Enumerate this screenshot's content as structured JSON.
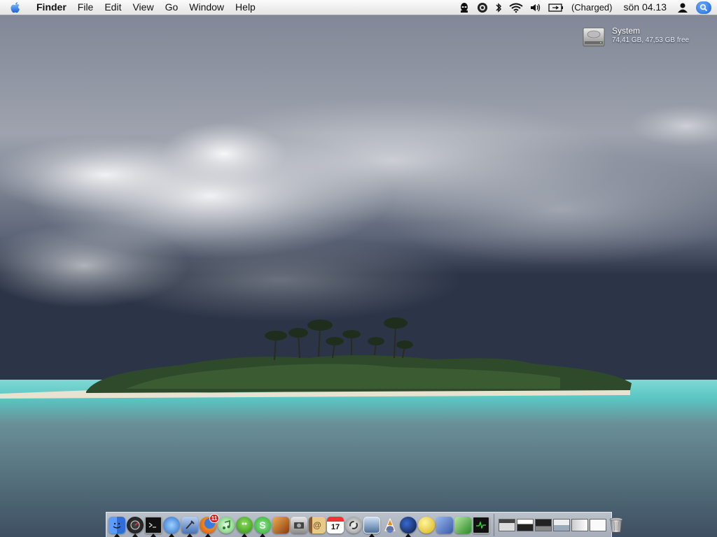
{
  "menubar": {
    "app_name": "Finder",
    "menus": [
      "File",
      "Edit",
      "View",
      "Go",
      "Window",
      "Help"
    ],
    "battery_status": "(Charged)",
    "clock": "sön 04.13"
  },
  "desktop_icon": {
    "name": "System",
    "info": "74,41 GB, 47,53 GB free"
  },
  "dock": {
    "badge_count": "11",
    "calendar_date": "17",
    "apps": [
      {
        "id": "finder",
        "icon": "finder-icon",
        "color": "#3a78d8"
      },
      {
        "id": "dashboard",
        "icon": "dashboard-icon",
        "color": "#222222"
      },
      {
        "id": "terminal",
        "icon": "terminal-icon",
        "color": "#1a1a1a"
      },
      {
        "id": "safari",
        "icon": "safari-icon",
        "color": "#4a9ae0"
      },
      {
        "id": "xcode",
        "icon": "xcode-icon",
        "color": "#6a8fd0"
      },
      {
        "id": "firefox",
        "icon": "firefox-icon",
        "color": "#e07a20"
      },
      {
        "id": "itunes",
        "icon": "itunes-icon",
        "color": "#5cc05c"
      },
      {
        "id": "adium",
        "icon": "adium-icon",
        "color": "#4caf2a"
      },
      {
        "id": "skype",
        "icon": "skype-icon",
        "color": "#3fb43f"
      },
      {
        "id": "photo-booth",
        "icon": "photo-icon",
        "color": "#b35e1e"
      },
      {
        "id": "iphoto",
        "icon": "camera-icon",
        "color": "#777777"
      },
      {
        "id": "address-book",
        "icon": "address-book-icon",
        "color": "#c89a4a"
      },
      {
        "id": "ical",
        "icon": "calendar-icon",
        "color": "#f4f4f4"
      },
      {
        "id": "sync",
        "icon": "sync-icon",
        "color": "#999999"
      },
      {
        "id": "preview",
        "icon": "preview-icon",
        "color": "#5b7ea8"
      },
      {
        "id": "vlc",
        "icon": "vlc-icon",
        "color": "#ee7a10"
      },
      {
        "id": "ssh",
        "icon": "ssh-icon",
        "color": "#1a3a6a"
      },
      {
        "id": "bubble",
        "icon": "yellow-ball-icon",
        "color": "#e8c820"
      },
      {
        "id": "delivery",
        "icon": "delivery-icon",
        "color": "#5a7ac8"
      },
      {
        "id": "money",
        "icon": "money-icon",
        "color": "#3a9a3a"
      },
      {
        "id": "activity-monitor",
        "icon": "activity-monitor-icon",
        "color": "#202020"
      }
    ]
  }
}
